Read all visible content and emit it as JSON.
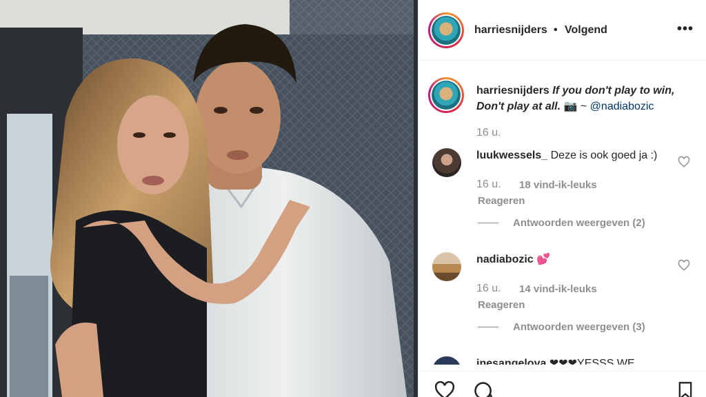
{
  "post": {
    "username": "harriesnijders",
    "separator": "•",
    "follow_status": "Volgend",
    "more_icon": "more-options-icon"
  },
  "caption": {
    "username": "harriesnijders",
    "text": "If you don't play to win, Don't play at all.",
    "camera": "📷",
    "tilde": "~",
    "mention": "@nadiabozic",
    "time": "16 u."
  },
  "comments": [
    {
      "username": "luukwessels_",
      "text": "Deze is ook goed ja :)",
      "time": "16 u.",
      "likes": "18 vind-ik-leuks",
      "reply": "Reageren",
      "view_replies": "Antwoorden weergeven (2)"
    },
    {
      "username": "nadiabozic",
      "text": "💕",
      "time": "16 u.",
      "likes": "14 vind-ik-leuks",
      "reply": "Reageren",
      "view_replies": "Antwoorden weergeven (3)"
    },
    {
      "username": "inesangelova",
      "text": "❤❤❤YESSS WE"
    }
  ],
  "colors": {
    "text": "#262626",
    "muted": "#8e8e8e",
    "link": "#003569",
    "heart": "#ed4956"
  }
}
